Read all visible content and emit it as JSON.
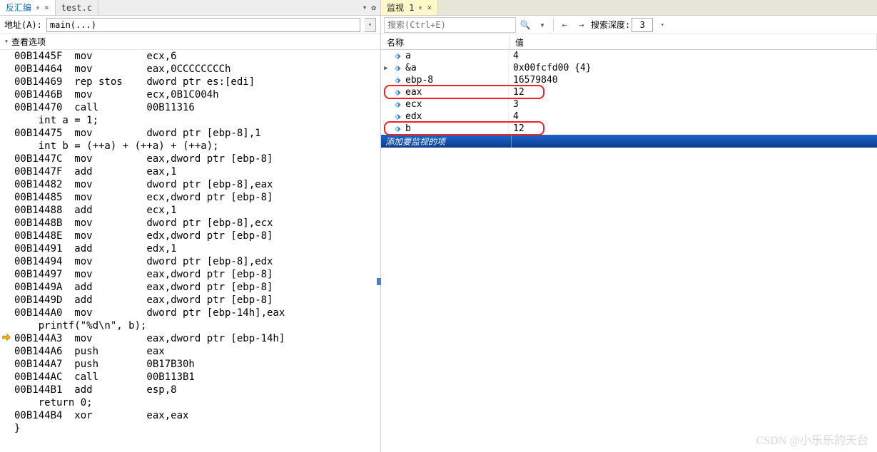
{
  "left": {
    "tabs": [
      {
        "label": "反汇编",
        "active": true
      },
      {
        "label": "test.c",
        "active": false
      }
    ],
    "address_label": "地址(A):",
    "address_value": "main(...)",
    "view_options_label": "查看选项",
    "current_line_index": 26,
    "code": [
      "00B1445F  mov         ecx,6",
      "00B14464  mov         eax,0CCCCCCCCh",
      "00B14469  rep stos    dword ptr es:[edi]",
      "00B1446B  mov         ecx,0B1C004h",
      "00B14470  call        00B11316",
      "    int a = 1;",
      "00B14475  mov         dword ptr [ebp-8],1",
      "    int b = (++a) + (++a) + (++a);",
      "00B1447C  mov         eax,dword ptr [ebp-8]",
      "00B1447F  add         eax,1",
      "00B14482  mov         dword ptr [ebp-8],eax",
      "00B14485  mov         ecx,dword ptr [ebp-8]",
      "00B14488  add         ecx,1",
      "00B1448B  mov         dword ptr [ebp-8],ecx",
      "00B1448E  mov         edx,dword ptr [ebp-8]",
      "00B14491  add         edx,1",
      "00B14494  mov         dword ptr [ebp-8],edx",
      "00B14497  mov         eax,dword ptr [ebp-8]",
      "00B1449A  add         eax,dword ptr [ebp-8]",
      "00B1449D  add         eax,dword ptr [ebp-8]",
      "00B144A0  mov         dword ptr [ebp-14h],eax",
      "    printf(\"%d\\n\", b);",
      "00B144A3  mov         eax,dword ptr [ebp-14h]",
      "00B144A6  push        eax",
      "00B144A7  push        0B17B30h",
      "00B144AC  call        00B113B1",
      "00B144B1  add         esp,8",
      "    return 0;",
      "00B144B4  xor         eax,eax",
      "}"
    ]
  },
  "right": {
    "tab_label": "监视 1",
    "search_placeholder": "搜索(Ctrl+E)",
    "depth_label": "搜索深度:",
    "depth_value": "3",
    "col_name": "名称",
    "col_value": "值",
    "rows": [
      {
        "exp": "",
        "name": "a",
        "value": "4",
        "hl": false
      },
      {
        "exp": "▶",
        "name": "&a",
        "value": "0x00fcfd00 {4}",
        "hl": false
      },
      {
        "exp": "",
        "name": "ebp-8",
        "value": "16579840",
        "hl": false
      },
      {
        "exp": "",
        "name": "eax",
        "value": "12",
        "hl": true
      },
      {
        "exp": "",
        "name": "ecx",
        "value": "3",
        "hl": false
      },
      {
        "exp": "",
        "name": "edx",
        "value": "4",
        "hl": false
      },
      {
        "exp": "",
        "name": "b",
        "value": "12",
        "hl": true
      }
    ],
    "add_hint": "添加要监视的项"
  },
  "watermark": "CSDN @小乐乐的天台"
}
